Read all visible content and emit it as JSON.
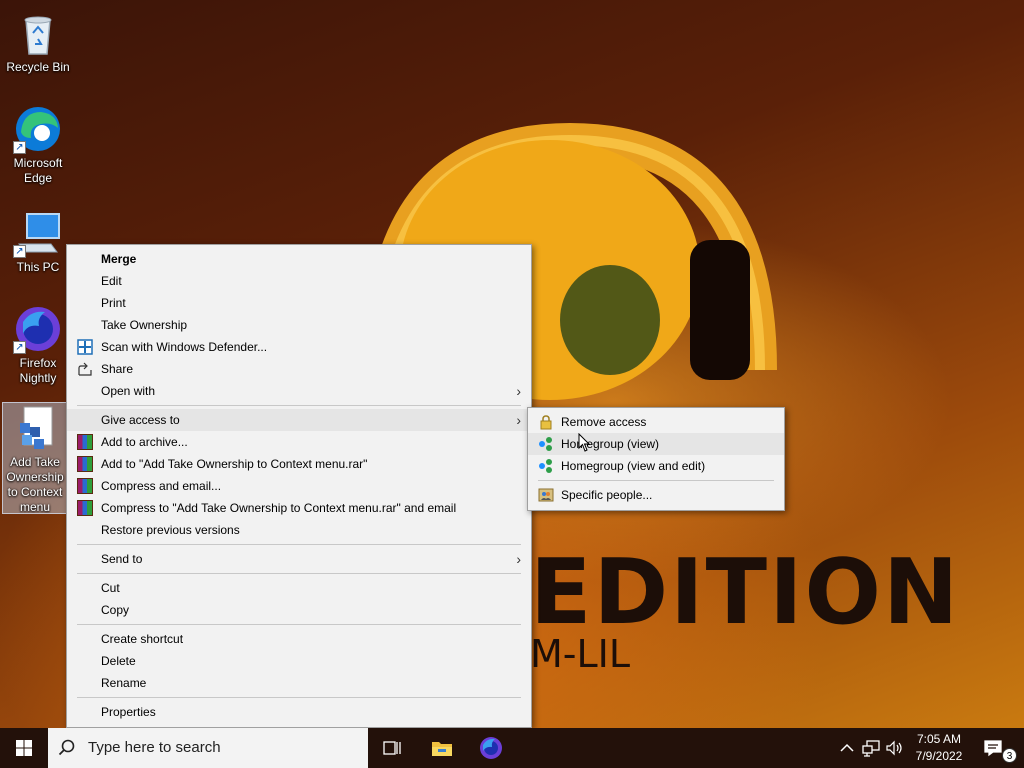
{
  "desktop": {
    "icons": [
      {
        "label": "Recycle Bin"
      },
      {
        "label": "Microsoft Edge"
      },
      {
        "label": "This PC"
      },
      {
        "label": "Firefox Nightly"
      },
      {
        "label": "Add Take Ownership to Context menu"
      }
    ],
    "wallpaper": {
      "headline": "EDITION",
      "subline": "M-LIL"
    }
  },
  "context_menu": {
    "items": [
      {
        "label": "Merge"
      },
      {
        "label": "Edit"
      },
      {
        "label": "Print"
      },
      {
        "label": "Take Ownership"
      },
      {
        "label": "Scan with Windows Defender..."
      },
      {
        "label": "Share"
      },
      {
        "label": "Open with"
      },
      {
        "label": "Give access to"
      },
      {
        "label": "Add to archive..."
      },
      {
        "label": "Add to \"Add Take Ownership to Context menu.rar\""
      },
      {
        "label": "Compress and email..."
      },
      {
        "label": "Compress to \"Add Take Ownership to Context menu.rar\" and email"
      },
      {
        "label": "Restore previous versions"
      },
      {
        "label": "Send to"
      },
      {
        "label": "Cut"
      },
      {
        "label": "Copy"
      },
      {
        "label": "Create shortcut"
      },
      {
        "label": "Delete"
      },
      {
        "label": "Rename"
      },
      {
        "label": "Properties"
      }
    ]
  },
  "submenu": {
    "items": [
      {
        "label": "Remove access"
      },
      {
        "label": "Homegroup (view)"
      },
      {
        "label": "Homegroup (view and edit)"
      },
      {
        "label": "Specific people..."
      }
    ]
  },
  "taskbar": {
    "search_placeholder": "Type here to search",
    "clock_time": "7:05 AM",
    "clock_date": "7/9/2022",
    "notification_count": "3"
  },
  "colors": {
    "menu_bg": "#f2f2f2",
    "menu_highlight": "#e5e5e5",
    "taskbar_bg": "#23110a"
  }
}
